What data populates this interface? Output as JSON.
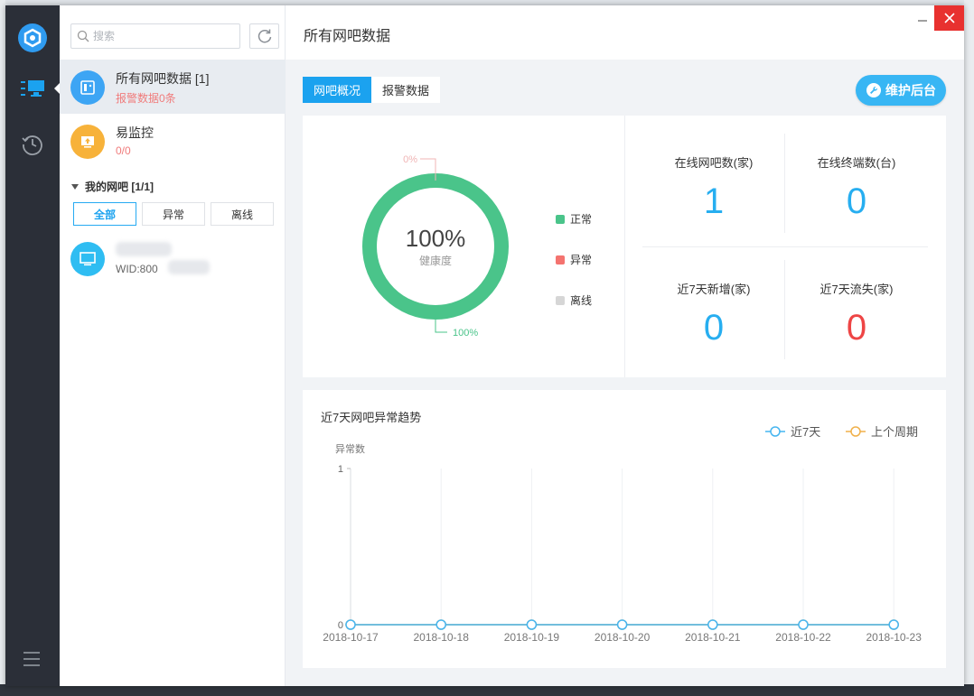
{
  "rail": {
    "items": [
      {
        "name": "monitor-list",
        "active": true
      },
      {
        "name": "history",
        "active": false
      }
    ]
  },
  "list": {
    "search_placeholder": "搜索",
    "items": [
      {
        "title": "所有网吧数据 [1]",
        "sub": "报警数据0条",
        "icon": "server-icon",
        "color": "#3da5f4"
      },
      {
        "title": "易监控",
        "sub": "0/0",
        "icon": "upload-monitor-icon",
        "color": "#f7b23a"
      }
    ],
    "group_label": "我的网吧 [1/1]",
    "filters": [
      "全部",
      "异常",
      "离线"
    ],
    "bar_wid": "WID:800"
  },
  "header": {
    "title": "所有网吧数据"
  },
  "tabs": [
    "网吧概况",
    "报警数据"
  ],
  "maint_button": "维护后台",
  "health": {
    "center_value": "100%",
    "center_label": "健康度",
    "top_label": "0%",
    "bottom_label": "100%",
    "legend": [
      {
        "label": "正常",
        "color": "#4ac48a"
      },
      {
        "label": "异常",
        "color": "#f4736f"
      },
      {
        "label": "离线",
        "color": "#d6d6d6"
      }
    ]
  },
  "stats": [
    {
      "label": "在线网吧数(家)",
      "value": "1",
      "color": "#27aef0"
    },
    {
      "label": "在线终端数(台)",
      "value": "0",
      "color": "#27aef0"
    },
    {
      "label": "近7天新增(家)",
      "value": "0",
      "color": "#27aef0"
    },
    {
      "label": "近7天流失(家)",
      "value": "0",
      "color": "#ee4545"
    }
  ],
  "chart_data": {
    "type": "line",
    "title": "近7天网吧异常趋势",
    "ylabel": "异常数",
    "ylim": [
      0,
      1
    ],
    "yticks": [
      "0",
      "1"
    ],
    "categories": [
      "2018-10-17",
      "2018-10-18",
      "2018-10-19",
      "2018-10-20",
      "2018-10-21",
      "2018-10-22",
      "2018-10-23"
    ],
    "series": [
      {
        "name": "近7天",
        "color": "#46b5f0",
        "values": [
          0,
          0,
          0,
          0,
          0,
          0,
          0
        ]
      },
      {
        "name": "上个周期",
        "color": "#f0b04a",
        "values": [
          0,
          0,
          0,
          0,
          0,
          0,
          0
        ]
      }
    ],
    "legend_position": "top-right"
  }
}
